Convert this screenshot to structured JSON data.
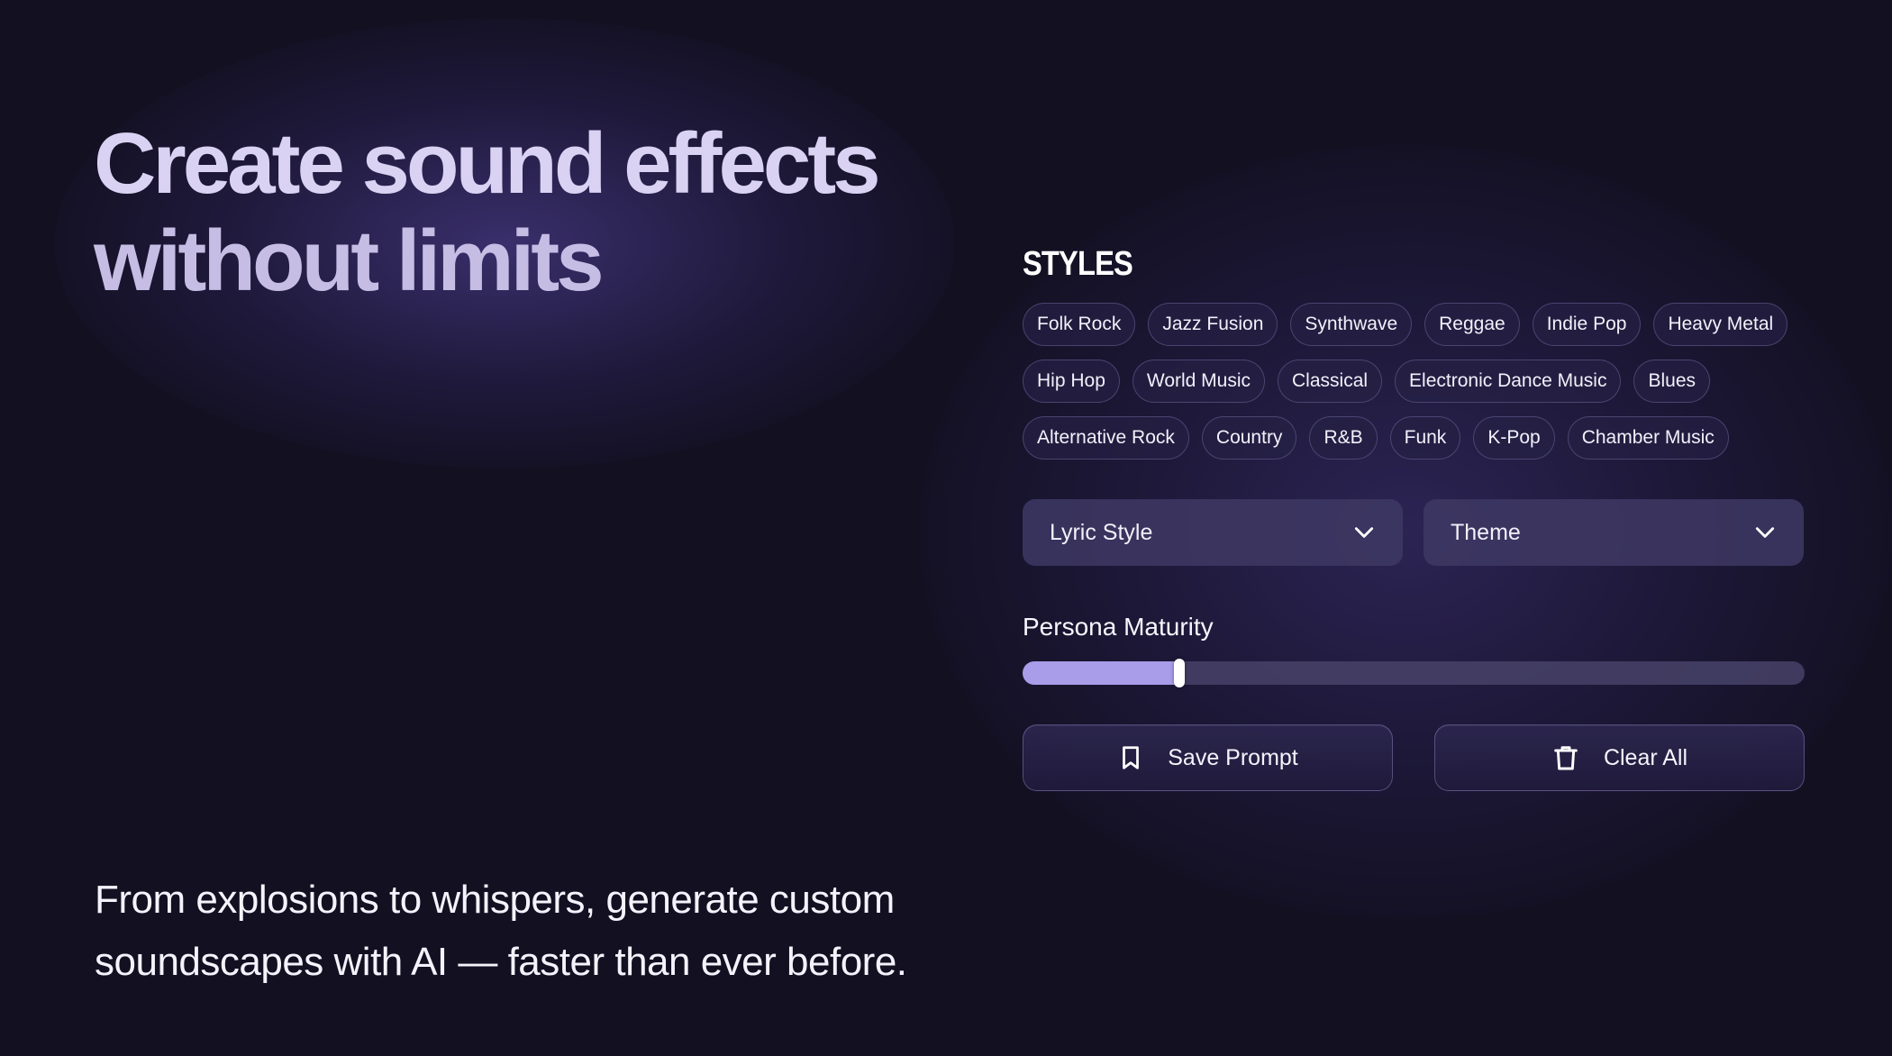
{
  "hero": {
    "title_line1": "Create sound effects",
    "title_line2": "without limits",
    "subtitle_line1": "From explosions to whispers, generate custom",
    "subtitle_line2": "soundscapes with AI — faster than ever before."
  },
  "styles": {
    "heading": "STYLES",
    "rows": [
      [
        "Folk Rock",
        "Jazz Fusion",
        "Synthwave",
        "Reggae",
        "Indie Pop",
        "Heavy Metal"
      ],
      [
        "Hip Hop",
        "World Music",
        "Classical",
        "Electronic Dance Music",
        "Blues"
      ],
      [
        "Alternative Rock",
        "Country",
        "R&B",
        "Funk",
        "K-Pop",
        "Chamber Music"
      ]
    ]
  },
  "selects": {
    "lyric_style": {
      "label": "Lyric Style",
      "icon": "chevron-down-icon"
    },
    "theme": {
      "label": "Theme",
      "icon": "chevron-down-icon"
    }
  },
  "slider": {
    "label": "Persona Maturity",
    "value": 0.2
  },
  "actions": {
    "save": {
      "label": "Save Prompt",
      "icon": "bookmark-icon"
    },
    "clear": {
      "label": "Clear All",
      "icon": "trash-icon"
    }
  },
  "colors": {
    "background": "#131022",
    "accent": "#a99ce9",
    "title": "#d9d2f2"
  }
}
